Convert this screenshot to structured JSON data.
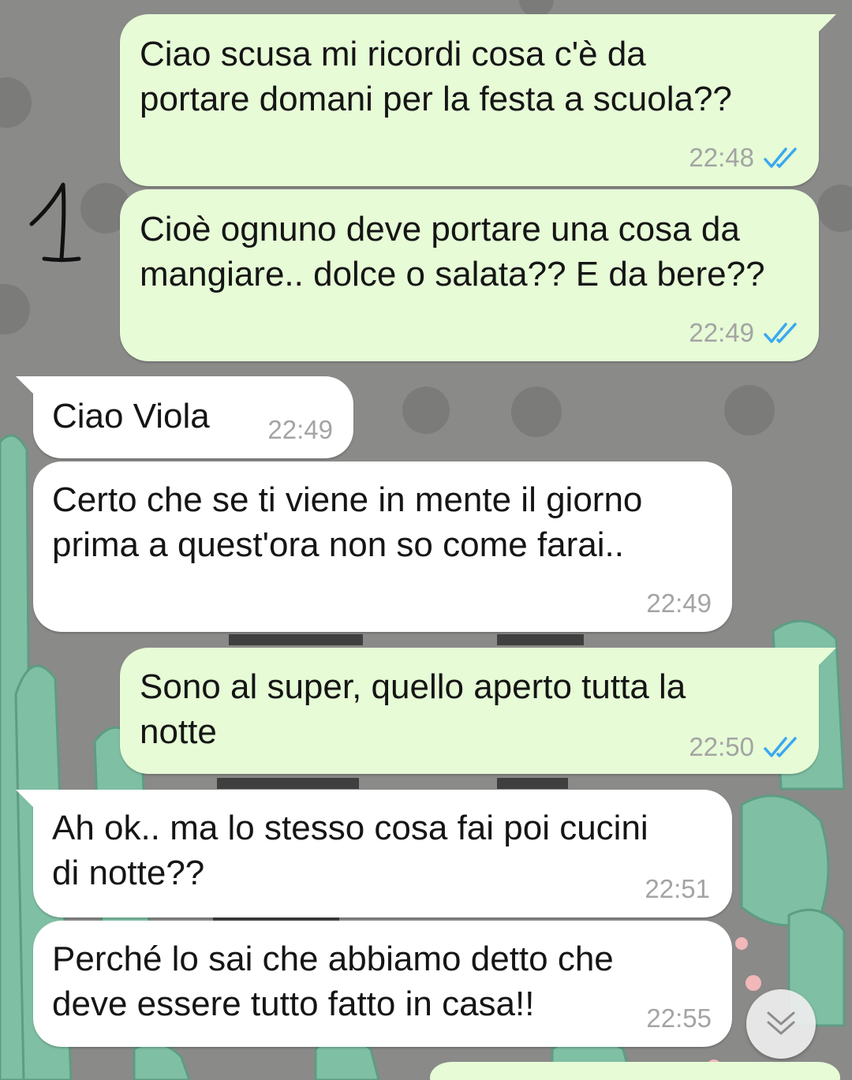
{
  "colors": {
    "outgoing_bubble": "#e6fbd6",
    "incoming_bubble": "#ffffff",
    "read_ticks": "#3aa8f0",
    "wallpaper_base": "#8a8a89",
    "wallpaper_dots": "#7b7b7a",
    "cactus_green": "#7fbfa4"
  },
  "annotation": {
    "label": "1"
  },
  "messages": [
    {
      "direction": "outgoing",
      "lines": [
        "Ciao scusa mi ricordi cosa c'è da",
        "portare domani per la festa a scuola??"
      ],
      "time": "22:48",
      "status_icon": "double-check-read-icon"
    },
    {
      "direction": "outgoing",
      "lines": [
        "Cioè ognuno deve portare una cosa da",
        "mangiare.. dolce o salata?? E da bere??"
      ],
      "time": "22:49",
      "status_icon": "double-check-read-icon"
    },
    {
      "direction": "incoming",
      "lines": [
        "Ciao Viola"
      ],
      "time": "22:49"
    },
    {
      "direction": "incoming",
      "lines": [
        "Certo che se ti viene in mente il giorno",
        "prima a quest'ora non so come farai.."
      ],
      "time": "22:49"
    },
    {
      "direction": "outgoing",
      "lines": [
        "Sono al super, quello aperto tutta la",
        "notte"
      ],
      "time": "22:50",
      "status_icon": "double-check-read-icon"
    },
    {
      "direction": "incoming",
      "lines": [
        "Ah ok.. ma lo stesso cosa fai poi cucini",
        "di notte??"
      ],
      "time": "22:51"
    },
    {
      "direction": "incoming",
      "lines": [
        "Perché lo sai che abbiamo detto che",
        "deve essere tutto fatto in casa!!"
      ],
      "time": "22:55"
    }
  ],
  "scroll_button": {
    "icon": "double-chevron-down-icon"
  }
}
